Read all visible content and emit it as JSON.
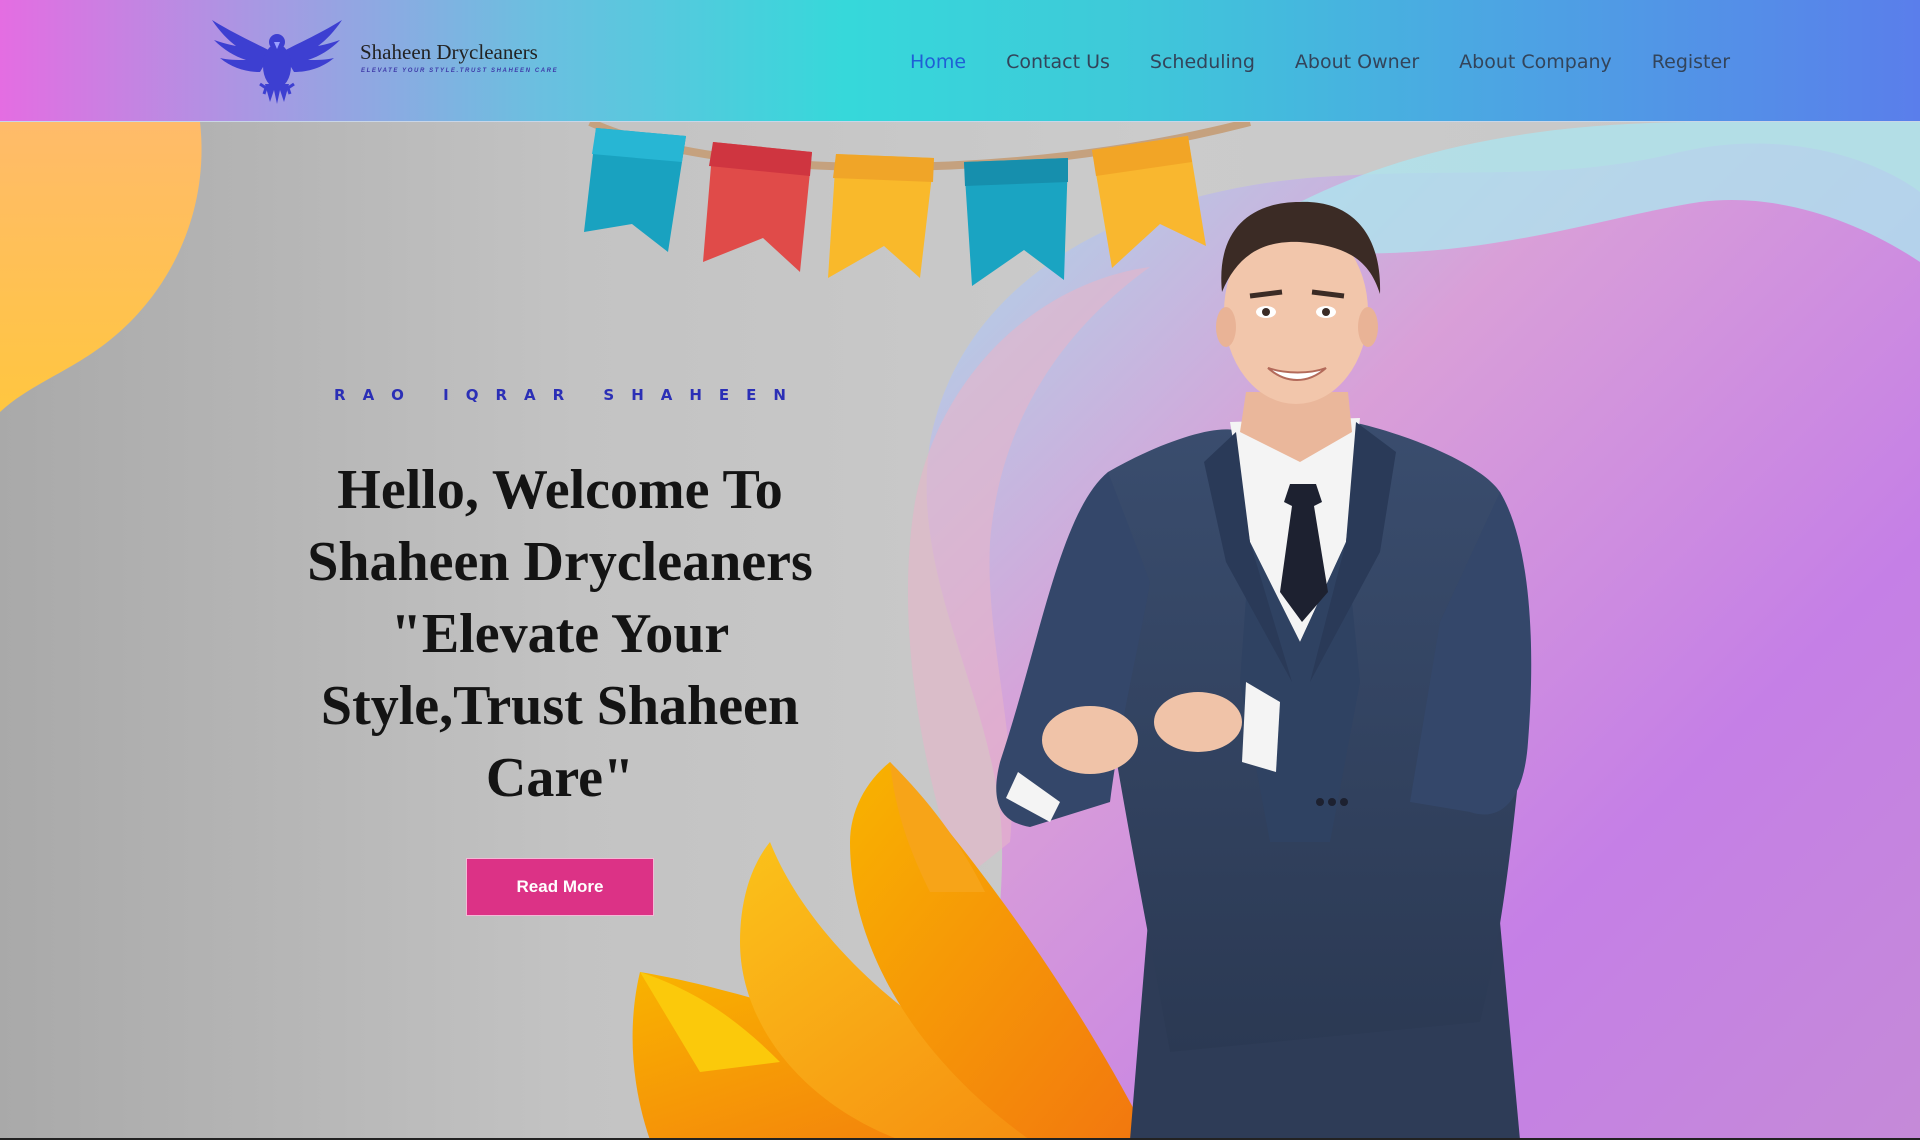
{
  "brand": {
    "name": "Shaheen Drycleaners",
    "tagline": "ELEVATE YOUR STYLE.TRUST SHAHEEN CARE",
    "logo_icon": "eagle-icon",
    "logo_color": "#3d3fd1"
  },
  "nav": {
    "items": [
      {
        "label": "Home",
        "active": true
      },
      {
        "label": "Contact Us",
        "active": false
      },
      {
        "label": "Scheduling",
        "active": false
      },
      {
        "label": "About Owner",
        "active": false
      },
      {
        "label": "About Company",
        "active": false
      },
      {
        "label": "Register",
        "active": false
      }
    ]
  },
  "hero": {
    "subtitle": "RAO IQRAR SHAHEEN",
    "headline": "Hello, Welcome To Shaheen Drycleaners \"Elevate Your Style,Trust Shaheen Care\"",
    "cta_label": "Read More",
    "cta_color": "#dc3286",
    "image": "man-in-suit-photo"
  },
  "colors": {
    "header_gradient_start": "#e46de2",
    "header_gradient_mid": "#36d8da",
    "header_gradient_end": "#5a7eeb",
    "nav_active": "#1f5fd6",
    "subtitle": "#2b2fb6"
  }
}
